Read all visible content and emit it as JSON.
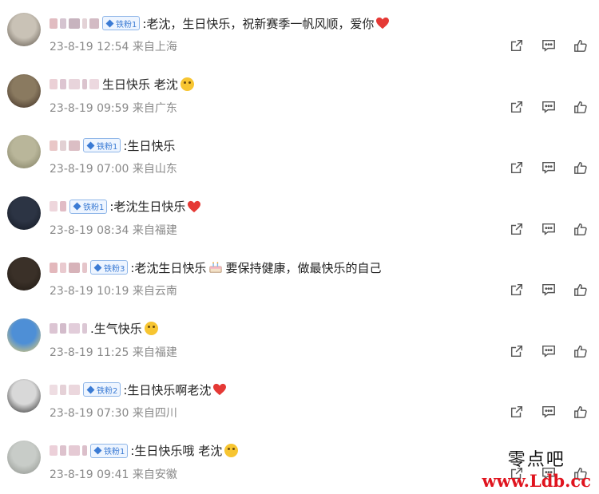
{
  "comments": [
    {
      "badge": "铁粉1",
      "text": ":老沈，生日快乐，祝新赛季一帆风顺，爱你",
      "emoji": "heart",
      "time": "23-8-19 12:54",
      "location": "来自上海",
      "avatar_colors": [
        "#c9c2b6",
        "#5a5248"
      ],
      "name_blocks": [
        "#d7a5ac",
        "#c7b0c0",
        "#b49aa8",
        "#d9c3c8",
        "#c4a4b0"
      ]
    },
    {
      "badge": "",
      "text": "生日快乐 老沈",
      "emoji": "face",
      "time": "23-8-19 09:59",
      "location": "来自广东",
      "avatar_colors": [
        "#8a7a60",
        "#3a2a20"
      ],
      "name_blocks": [
        "#e4c0c8",
        "#d2b2c2",
        "#e0c6cf",
        "#cfb0be",
        "#e6cbd4"
      ]
    },
    {
      "badge": "铁粉1",
      "text": ":生日快乐",
      "emoji": "",
      "time": "23-8-19 07:00",
      "location": "来自山东",
      "avatar_colors": [
        "#b9b69a",
        "#7c7a5e"
      ],
      "name_blocks": [
        "#e2b4b4",
        "#d8c0c4",
        "#cfa8b0"
      ]
    },
    {
      "badge": "铁粉1",
      "text": ":老沈生日快乐",
      "emoji": "heart",
      "time": "23-8-19 08:34",
      "location": "来自福建",
      "avatar_colors": [
        "#2c3444",
        "#121822"
      ],
      "name_blocks": [
        "#e8c8d0",
        "#d7a6b2"
      ]
    },
    {
      "badge": "铁粉3",
      "text": ":老沈生日快乐",
      "emoji": "cake",
      "text2": "要保持健康，做最快乐的自己",
      "time": "23-8-19 10:19",
      "location": "来自云南",
      "avatar_colors": [
        "#3a3028",
        "#1e1812"
      ],
      "name_blocks": [
        "#d9a0a6",
        "#e2b8bf",
        "#c99aa2",
        "#dcb2b8"
      ]
    },
    {
      "badge": "",
      "text": ".生气快乐",
      "emoji": "face",
      "time": "23-8-19 11:25",
      "location": "来自福建",
      "avatar_colors": [
        "#4e8fd6",
        "#f2d26a"
      ],
      "name_blocks": [
        "#d0b2c4",
        "#c4a6ba",
        "#d8bccd",
        "#cfb4c6"
      ]
    },
    {
      "badge": "铁粉2",
      "text": ":生日快乐啊老沈",
      "emoji": "heart",
      "time": "23-8-19 07:30",
      "location": "来自四川",
      "avatar_colors": [
        "#d8d8d8",
        "#202020"
      ],
      "name_blocks": [
        "#e8d2d8",
        "#dcc2ca",
        "#e4cad2"
      ]
    },
    {
      "badge": "铁粉1",
      "text": ":生日快乐哦 老沈",
      "emoji": "face",
      "time": "23-8-19 09:41",
      "location": "来自安徽",
      "avatar_colors": [
        "#c8ccc8",
        "#8a8e88"
      ],
      "name_blocks": [
        "#e6c0cc",
        "#d2aebc",
        "#dcb8c6",
        "#cfa9b8"
      ]
    }
  ],
  "actions": {
    "icons": [
      "share-icon",
      "comment-icon",
      "like-icon"
    ]
  },
  "watermark": {
    "top": "零点吧",
    "url": "www.Ldb.cc"
  }
}
